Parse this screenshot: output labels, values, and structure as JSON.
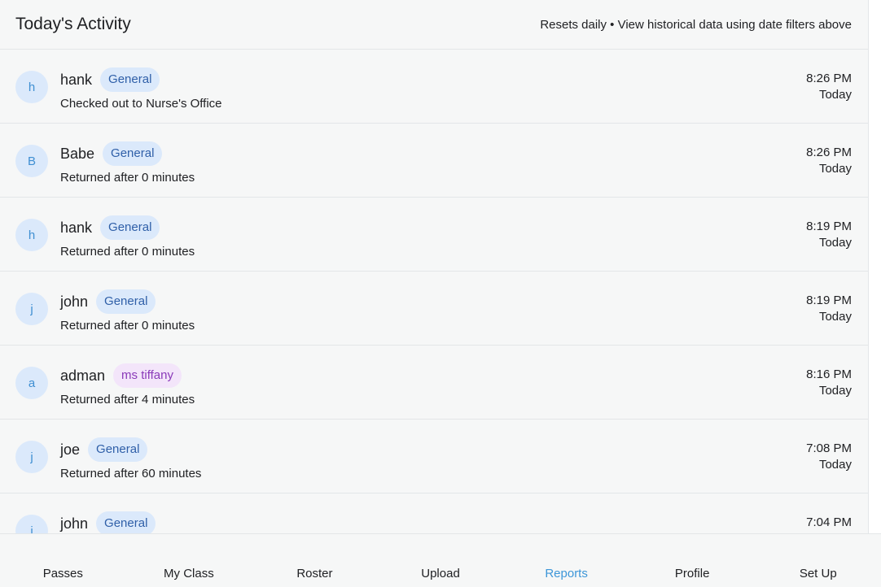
{
  "header": {
    "title": "Today's Activity",
    "note": "Resets daily • View historical data using date filters above"
  },
  "colors": {
    "tag_blue_bg": "#dbe9fb",
    "tag_purple_bg": "#f3e5fa",
    "active_nav": "#3d96d8"
  },
  "activities": [
    {
      "initial": "h",
      "name": "hank",
      "tag": "General",
      "tag_color": "blue",
      "status": "Checked out to Nurse's Office",
      "time": "8:26 PM",
      "day": "Today"
    },
    {
      "initial": "B",
      "name": "Babe",
      "tag": "General",
      "tag_color": "blue",
      "status": "Returned after 0 minutes",
      "time": "8:26 PM",
      "day": "Today"
    },
    {
      "initial": "h",
      "name": "hank",
      "tag": "General",
      "tag_color": "blue",
      "status": "Returned after 0 minutes",
      "time": "8:19 PM",
      "day": "Today"
    },
    {
      "initial": "j",
      "name": "john",
      "tag": "General",
      "tag_color": "blue",
      "status": "Returned after 0 minutes",
      "time": "8:19 PM",
      "day": "Today"
    },
    {
      "initial": "a",
      "name": "adman",
      "tag": "ms tiffany",
      "tag_color": "purple",
      "status": "Returned after 4 minutes",
      "time": "8:16 PM",
      "day": "Today"
    },
    {
      "initial": "j",
      "name": "joe",
      "tag": "General",
      "tag_color": "blue",
      "status": "Returned after 60 minutes",
      "time": "7:08 PM",
      "day": "Today"
    },
    {
      "initial": "j",
      "name": "john",
      "tag": "General",
      "tag_color": "blue",
      "status": "",
      "time": "7:04 PM",
      "day": ""
    }
  ],
  "nav": {
    "items": [
      "Passes",
      "My Class",
      "Roster",
      "Upload",
      "Reports",
      "Profile",
      "Set Up"
    ],
    "active": "Reports"
  }
}
